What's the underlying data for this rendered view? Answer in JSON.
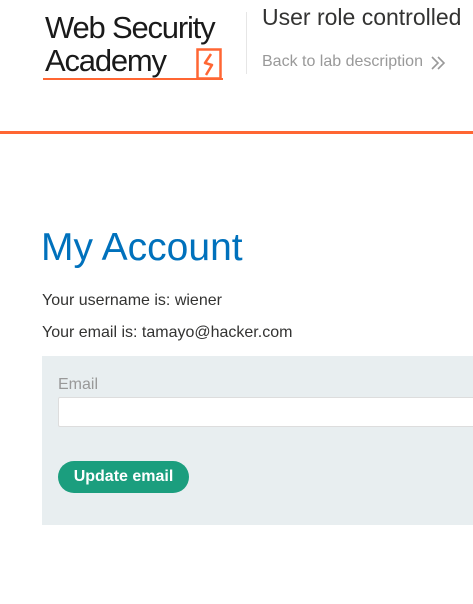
{
  "header": {
    "logo_line1": "Web Security",
    "logo_line2": "Academy",
    "lab_title": "User role controlled",
    "back_link": "Back to lab description",
    "accent_color": "#ff6633"
  },
  "main": {
    "title": "My Account",
    "username_line": "Your username is: wiener",
    "email_line": "Your email is: tamayo@hacker.com"
  },
  "form": {
    "email_label": "Email",
    "email_value": "",
    "submit_label": "Update email",
    "button_color": "#1b9e7e"
  },
  "icons": {
    "logo_mark": "lightning-bolt-icon",
    "back_link_icon": "double-chevron-right-icon"
  }
}
